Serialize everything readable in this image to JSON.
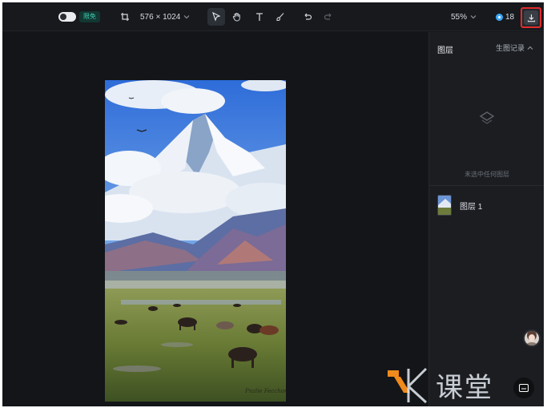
{
  "toolbar": {
    "badge_label": "限免",
    "canvas_size": "576 × 1024",
    "zoom_level": "55%",
    "credits": "18"
  },
  "panel": {
    "title": "图层",
    "history_label": "生图记录",
    "empty_message": "未选中任何图层",
    "layers": [
      {
        "name": "图层 1"
      }
    ]
  },
  "artwork": {
    "signature": "Pnzlie Fecchon"
  },
  "watermark": {
    "text": "课堂"
  },
  "colors": {
    "accent_badge": "#3ecfb0",
    "download_highlight": "#e02c2c",
    "credit_coin": "#3aa9ff"
  }
}
